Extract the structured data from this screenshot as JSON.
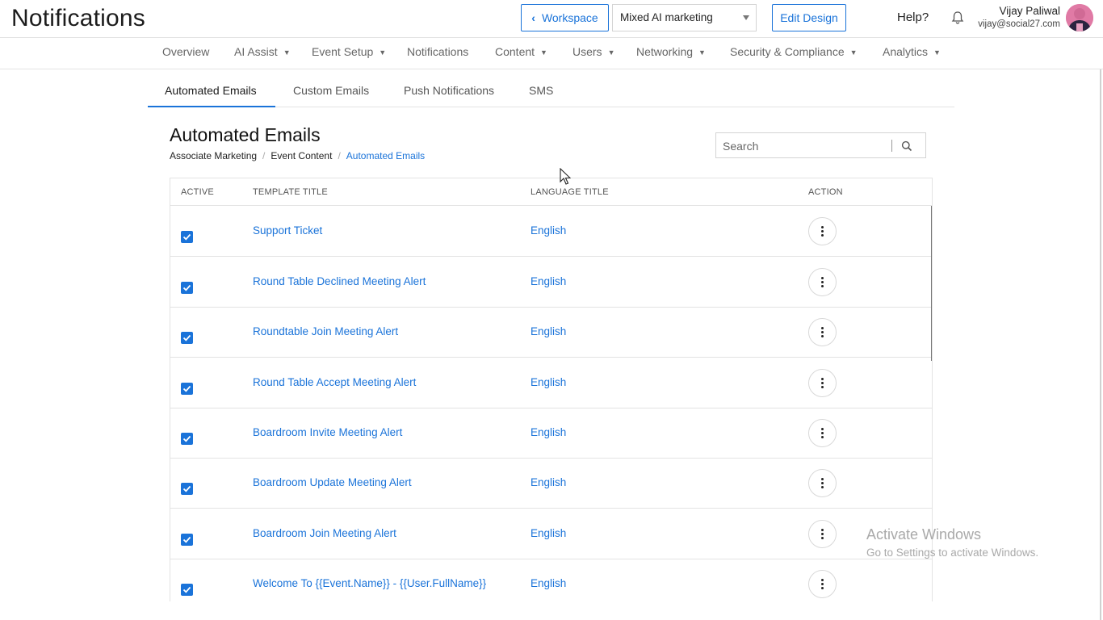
{
  "header": {
    "title": "Notifications",
    "workspace_label": "Workspace",
    "event_selected": "Mixed AI marketing",
    "edit_design_label": "Edit Design",
    "help_label": "Help?",
    "user_name": "Vijay Paliwal",
    "user_email": "vijay@social27.com"
  },
  "nav": {
    "items": [
      {
        "label": "Overview",
        "dropdown": false
      },
      {
        "label": "AI Assist",
        "dropdown": true
      },
      {
        "label": "Event Setup",
        "dropdown": true
      },
      {
        "label": "Notifications",
        "dropdown": false
      },
      {
        "label": "Content",
        "dropdown": true
      },
      {
        "label": "Users",
        "dropdown": true
      },
      {
        "label": "Networking",
        "dropdown": true
      },
      {
        "label": "Security & Compliance",
        "dropdown": true
      },
      {
        "label": "Analytics",
        "dropdown": true
      }
    ]
  },
  "tabs": [
    {
      "label": "Automated Emails",
      "active": true
    },
    {
      "label": "Custom Emails",
      "active": false
    },
    {
      "label": "Push Notifications",
      "active": false
    },
    {
      "label": "SMS",
      "active": false
    }
  ],
  "section": {
    "title": "Automated Emails",
    "breadcrumb": [
      "Associate Marketing",
      "Event Content",
      "Automated Emails"
    ],
    "search_placeholder": "Search"
  },
  "table": {
    "columns": [
      "ACTIVE",
      "TEMPLATE TITLE",
      "LANGUAGE TITLE",
      "ACTION"
    ],
    "rows": [
      {
        "active": true,
        "template": "Support Ticket",
        "language": "English"
      },
      {
        "active": true,
        "template": "Round Table Declined Meeting Alert",
        "language": "English"
      },
      {
        "active": true,
        "template": "Roundtable Join Meeting Alert",
        "language": "English"
      },
      {
        "active": true,
        "template": "Round Table Accept Meeting Alert",
        "language": "English"
      },
      {
        "active": true,
        "template": "Boardroom Invite Meeting Alert",
        "language": "English"
      },
      {
        "active": true,
        "template": "Boardroom Update Meeting Alert",
        "language": "English"
      },
      {
        "active": true,
        "template": "Boardroom Join Meeting Alert",
        "language": "English"
      },
      {
        "active": true,
        "template": "Welcome To {{Event.Name}} - {{User.FullName}}",
        "language": "English"
      }
    ]
  },
  "watermark": {
    "title": "Activate Windows",
    "subtitle": "Go to Settings to activate Windows."
  },
  "colors": {
    "accent": "#1a73d9",
    "border": "#e3e3e3",
    "avatar": "#e07aa5"
  }
}
